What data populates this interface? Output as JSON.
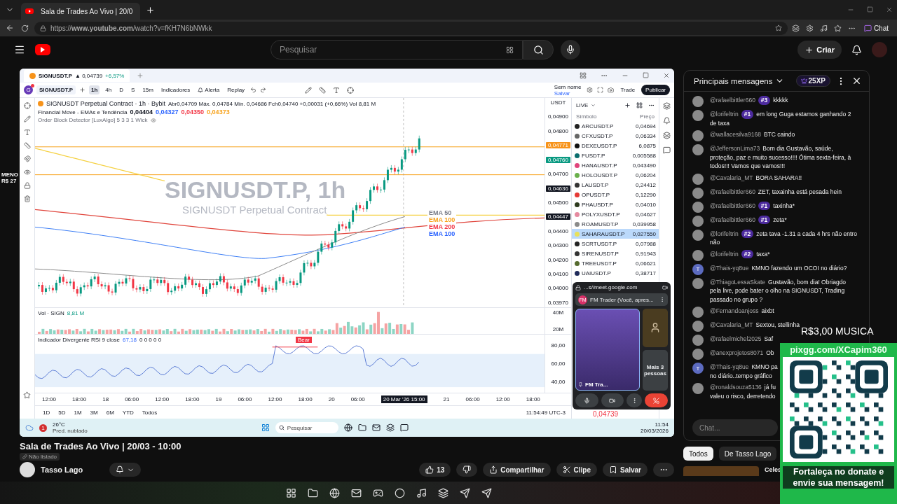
{
  "browser": {
    "tab_title": "Sala de Trades Ao Vivo | 20/0",
    "url": "https://**www.youtube.com**/watch?v=fKH7N6bNWkk",
    "chat_button": "Chat"
  },
  "youtube": {
    "search_placeholder": "Pesquisar",
    "create_button": "Criar"
  },
  "left_overlay": [
    "MENO",
    "R$ 27"
  ],
  "trading": {
    "tab": {
      "symbol": "SIGNUSDT.P",
      "price": "▲ 0,04739",
      "change": "+6,57%"
    },
    "toolbar": {
      "avatar": "G",
      "symbol": "SIGNUSDT.P",
      "intervals": [
        {
          "label": "1h",
          "selected": true
        },
        {
          "label": "4h",
          "selected": false
        },
        {
          "label": "D",
          "selected": false
        },
        {
          "label": "S",
          "selected": false
        },
        {
          "label": "15m",
          "selected": false
        }
      ],
      "indicators": "Indicadores",
      "alert": "Alerta",
      "replay": "Replay",
      "layout_name": "Sem nome",
      "layout_hint": "Salvar",
      "trade": "Trade",
      "publish": "Publicar"
    },
    "legend": {
      "title": "SIGNUSDT Perpetual Contract · 1h · Bybit",
      "ohlc": "Abr0,04709 Máx. 0,04784 Mín. 0,04686 Fch0,04740 +0,00031 (+0,66%) Vol 8,81 M",
      "indicator": "Financial Move - EMAs e Tendência",
      "indicator_values": [
        {
          "text": "0,04404",
          "color": "#131722"
        },
        {
          "text": "0,04327",
          "color": "#2962ff"
        },
        {
          "text": "0,04350",
          "color": "#f23645"
        },
        {
          "text": "0,04373",
          "color": "#f7a21b"
        }
      ],
      "order_block": "Order Block Detector [LuxAlgo] 5 3 3 1 Wick"
    },
    "watermark": [
      "SIGNUSDT.P, 1h",
      "SIGNUSDT Perpetual Contract"
    ],
    "ema_labels": [
      {
        "text": "EMA 50",
        "color": "#787b86"
      },
      {
        "text": "EMA 100",
        "color": "#f7a21b"
      },
      {
        "text": "EMA 200",
        "color": "#f23645"
      },
      {
        "text": "EMA 100",
        "color": "#2962ff"
      }
    ],
    "currency": "USDT",
    "price_axis": [
      {
        "text": "0,04900",
        "kind": "plain"
      },
      {
        "text": "0,04800",
        "kind": "plain"
      },
      {
        "text": "0,04771",
        "kind": "tag",
        "color": "#f7931a"
      },
      {
        "text": "0,04760",
        "kind": "tag",
        "color": "#089981"
      },
      {
        "text": "0,04700",
        "kind": "plain"
      },
      {
        "text": "0,04636",
        "kind": "tag",
        "color": "#131722"
      },
      {
        "text": "0,04500",
        "kind": "plain"
      },
      {
        "text": "0,04447",
        "kind": "tag",
        "color": "#131722"
      },
      {
        "text": "0,04400",
        "kind": "plain"
      },
      {
        "text": "0,04300",
        "kind": "plain"
      },
      {
        "text": "0,04200",
        "kind": "plain"
      },
      {
        "text": "0,04100",
        "kind": "plain"
      },
      {
        "text": "0,04000",
        "kind": "plain"
      },
      {
        "text": "0,03970",
        "kind": "plain"
      }
    ],
    "volume": {
      "title": "Vol · SIGN",
      "value": "8,81 M",
      "axis": [
        "40M",
        "20M"
      ]
    },
    "rsi": {
      "title": "Indicador Divergente RSI 9 close",
      "value": "67,18",
      "extras": "0 0 0 0 0",
      "tag": "Bear",
      "axis": [
        "80,00",
        "60,00",
        "40,00"
      ]
    },
    "time_axis": [
      "12:00",
      "18:00",
      "18",
      "06:00",
      "12:00",
      "18:00",
      "19",
      "06:00",
      "12:00",
      "18:00",
      "20",
      "06:00",
      "20 Mar '26  15:00",
      "21",
      "06:00",
      "12:00",
      "18:00"
    ],
    "ranges": [
      "1D",
      "5D",
      "1M",
      "3M",
      "6M",
      "YTD",
      "Todos"
    ],
    "clock": "11:54:49 UTC-3",
    "watchlist": {
      "title": "LIVE",
      "col_symbol": "Símbolo",
      "col_price": "Preço",
      "rows": [
        {
          "symbol": "ARCUSDT.P",
          "price": "0,04694",
          "color": "#222222",
          "selected": false
        },
        {
          "symbol": "CFXUSDT.P",
          "price": "0,06334",
          "color": "#666666",
          "selected": false
        },
        {
          "symbol": "DEXEUSDT.P",
          "price": "6,0875",
          "color": "#111111",
          "selected": false
        },
        {
          "symbol": "FUSDT.P",
          "price": "0,005588",
          "color": "#0b6e6e",
          "selected": false
        },
        {
          "symbol": "HANAUSDT.P",
          "price": "0,043490",
          "color": "#e0457b",
          "selected": false
        },
        {
          "symbol": "HOLOUSDT.P",
          "price": "0,06204",
          "color": "#6ab04c",
          "selected": false
        },
        {
          "symbol": "LAUSDT.P",
          "price": "0,24412",
          "color": "#333333",
          "selected": false
        },
        {
          "symbol": "OPUSDT.P",
          "price": "0,12290",
          "color": "#e53935",
          "selected": false
        },
        {
          "symbol": "PHAUSDT.P",
          "price": "0,04010",
          "color": "#2d3a1e",
          "selected": false
        },
        {
          "symbol": "POLYXUSDT.P",
          "price": "0,04627",
          "color": "#e58aa0",
          "selected": false
        },
        {
          "symbol": "ROAMUSDT.P",
          "price": "0,039958",
          "color": "#8a8a8a",
          "selected": false
        },
        {
          "symbol": "SAHARAUSDT.P",
          "price": "0,027550",
          "color": "#e8e05a",
          "selected": true
        },
        {
          "symbol": "SCRTUSDT.P",
          "price": "0,07988",
          "color": "#222222",
          "selected": false
        },
        {
          "symbol": "SIRENUSDT.P",
          "price": "0,91943",
          "color": "#333333",
          "selected": false
        },
        {
          "symbol": "TREEUSDT.P",
          "price": "0,06621",
          "color": "#556b2f",
          "selected": false
        },
        {
          "symbol": "UAIUSDT.P",
          "price": "0,38717",
          "color": "#1f2a5a",
          "selected": false
        }
      ]
    },
    "meet": {
      "url": "...s//meet.google.com",
      "presenter_initials": "FM",
      "presenter": "FM Trader (Você, apres...",
      "self_name": "FM Tra...",
      "more": "Mais 3 pessoas"
    },
    "last_price": "0,04739",
    "windows": {
      "weather_badge": "1",
      "temperature": "26°C",
      "weather": "Pred. nublado",
      "search": "Pesquisar",
      "time": "11:54",
      "date": "20/03/2026"
    }
  },
  "video_info": {
    "title": "Sala de Trades Ao Vivo | 20/03 - 10:00",
    "visibility": "Não listado",
    "channel": "Tasso Lago",
    "likes": "13",
    "share": "Compartilhar",
    "clip": "Clipe",
    "save": "Salvar"
  },
  "chat": {
    "title": "Principais mensagens",
    "xp": "25XP",
    "messages": [
      {
        "author": "@rafaelbittler660",
        "rank": "#3",
        "text": "kkkkk",
        "avatar": {
          "kind": "photo"
        }
      },
      {
        "author": "@lorifeltrin",
        "rank": "#1",
        "text": "em long Guga estamos ganhando 2 de taxa",
        "avatar": {
          "kind": "photo"
        }
      },
      {
        "author": "@wallacesilva9168",
        "text": "BTC caindo",
        "avatar": {
          "kind": "photo"
        }
      },
      {
        "author": "@JeffersonLima73",
        "text": "Bom dia Gustavão, saúde, proteção, paz e muito sucesso!!!! Ótima sexta-feira, à todos!!! Vamos que vamos!!!",
        "avatar": {
          "kind": "photo"
        }
      },
      {
        "author": "@Cavalaria_MT",
        "text": "BORA SAHARA!!",
        "avatar": {
          "kind": "photo"
        }
      },
      {
        "author": "@rafaelbittler660",
        "text": "ZET, taxainha está pesada hein",
        "avatar": {
          "kind": "photo"
        }
      },
      {
        "author": "@rafaelbittler660",
        "rank": "#1",
        "text": "taxinha*",
        "avatar": {
          "kind": "photo"
        }
      },
      {
        "author": "@rafaelbittler660",
        "rank": "#1",
        "text": "zeta*",
        "avatar": {
          "kind": "photo"
        }
      },
      {
        "author": "@lorifeltrin",
        "rank": "#2",
        "text": "zeta tava -1.31 a cada 4 hrs não entro não",
        "avatar": {
          "kind": "photo"
        }
      },
      {
        "author": "@lorifeltrin",
        "rank": "#2",
        "text": "taxa*",
        "avatar": {
          "kind": "photo"
        }
      },
      {
        "author": "@Thais-yq8ue",
        "text": "KMNO fazendo um OCOI no diário?",
        "avatar": {
          "kind": "letter",
          "letter": "T"
        }
      },
      {
        "author": "@ThiagoLessaSkate",
        "text": "Gustavão, bom dia! Obriagdo pela live, pode bater o olho na SIGNUSDT, Trading passado no grupo ?",
        "avatar": {
          "kind": "photo"
        }
      },
      {
        "author": "@Fernandoanjoss",
        "text": "aixbt",
        "avatar": {
          "kind": "photo"
        }
      },
      {
        "author": "@Cavalaria_MT",
        "text": "Sextou, stellinha",
        "avatar": {
          "kind": "photo"
        }
      },
      {
        "author": "@rafaelmichel2025",
        "text": "Saf",
        "avatar": {
          "kind": "photo"
        }
      },
      {
        "author": "@anexprojetos8071",
        "text": "Ob",
        "avatar": {
          "kind": "photo"
        }
      },
      {
        "author": "@Thais-yq8ue",
        "text": "KMNO pa",
        "text2": "no diário..tempo gráfico",
        "avatar": {
          "kind": "letter",
          "letter": "T"
        }
      },
      {
        "author": "@ronaldsouza5136",
        "text": "já fu",
        "text2": "valeu o risco, derretendo",
        "avatar": {
          "kind": "photo"
        }
      }
    ],
    "input_placeholder": "Chat...",
    "chips": [
      {
        "label": "Todos",
        "selected": true
      },
      {
        "label": "De Tasso Lago",
        "selected": false
      }
    ],
    "related_title": "Celes"
  },
  "donation": {
    "amount": "R$3,00 MUSICA",
    "url": "pixgg.com/XCapim360",
    "caption": "Fortaleça no donate e envie sua mensagem!"
  }
}
